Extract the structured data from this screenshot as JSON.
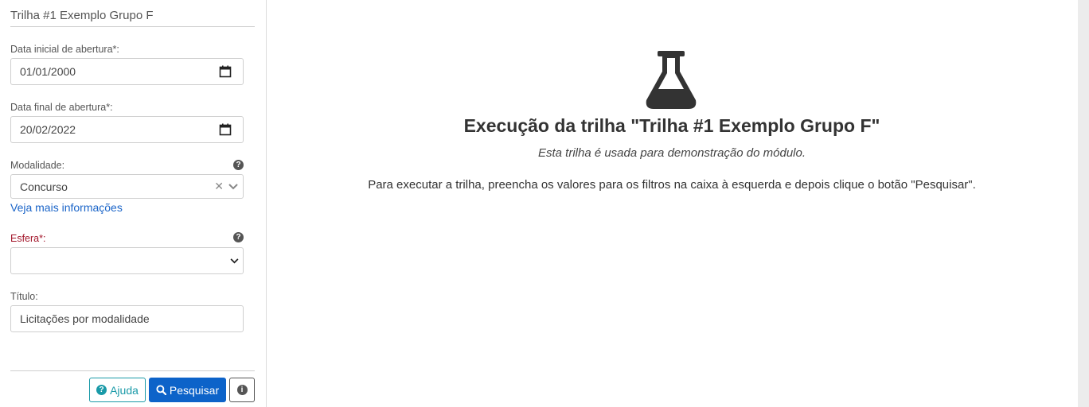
{
  "sidebar": {
    "title": "Trilha #1 Exemplo Grupo F",
    "data_inicial": {
      "label": "Data inicial de abertura*:",
      "value": "01/01/2000"
    },
    "data_final": {
      "label": "Data final de abertura*:",
      "value": "20/02/2022"
    },
    "modalidade": {
      "label": "Modalidade:",
      "value": "Concurso",
      "more_link": "Veja mais informações"
    },
    "esfera": {
      "label": "Esfera*:",
      "value": ""
    },
    "titulo": {
      "label": "Título:",
      "value": "Licitações por modalidade"
    },
    "buttons": {
      "ajuda": "Ajuda",
      "pesquisar": "Pesquisar"
    }
  },
  "main": {
    "title": "Execução da trilha \"Trilha #1 Exemplo Grupo F\"",
    "subtitle": "Esta trilha é usada para demonstração do módulo.",
    "instructions": "Para executar a trilha, preencha os valores para os filtros na caixa à esquerda e depois clique o botão \"Pesquisar\"."
  },
  "icons": {
    "main": "flask-icon",
    "calendar": "calendar-icon",
    "help": "question-circle-icon",
    "search": "search-icon",
    "info": "info-circle-icon"
  },
  "colors": {
    "primary": "#0d63c9",
    "help": "#1a9aa8",
    "required": "#a3172b",
    "link": "#1a64c8"
  }
}
